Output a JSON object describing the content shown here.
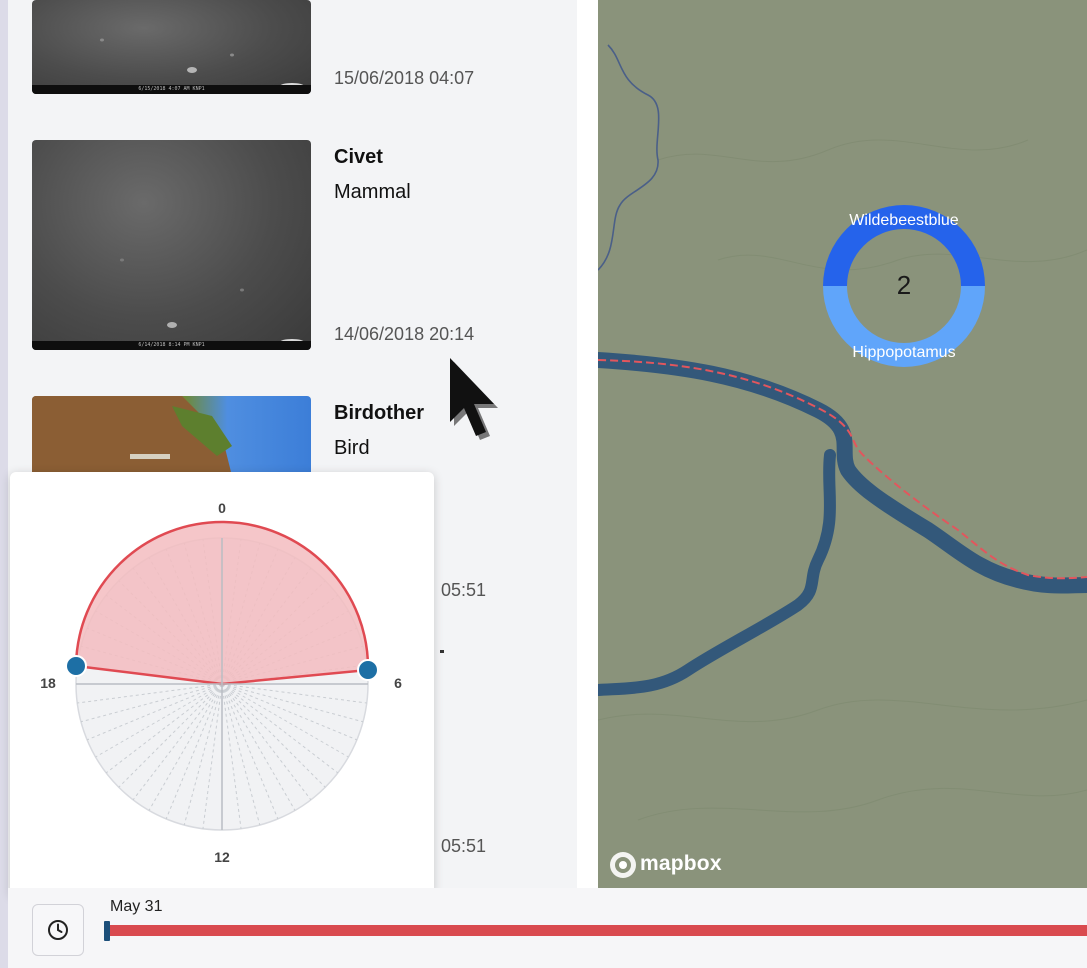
{
  "colors": {
    "map_background": "#8a937b",
    "river": "#33587a",
    "track": "#e2565d",
    "donut_top": "#2563eb",
    "donut_bottom": "#60a5fa",
    "clock_fill": "#f3bcbf",
    "clock_handle": "#1d6fa5",
    "timeline": "#d94a4f"
  },
  "sightings": [
    {
      "species": "",
      "category": "",
      "timestamp": "15/06/2018 04:07",
      "banner": "6/15/2018  4:07 AM  KNP1"
    },
    {
      "species": "Civet",
      "category": "Mammal",
      "timestamp": "14/06/2018 20:14",
      "banner": "6/14/2018  8:14 PM  KNP1"
    },
    {
      "species": "Birdother",
      "category": "Bird",
      "timestamp": "05:51"
    },
    {
      "species": "",
      "category": "",
      "timestamp": "05:51"
    }
  ],
  "map": {
    "cluster": {
      "count": "2",
      "top_label": "Wildebeestblue",
      "bottom_label": "Hippopotamus"
    },
    "attribution": "mapbox"
  },
  "clock_filter": {
    "labels": {
      "top": "0",
      "right": "6",
      "bottom": "12",
      "left": "18"
    },
    "range_start_hour": 18,
    "range_end_hour": 6
  },
  "timeline": {
    "start_label": "May 31",
    "icon": "clock-icon"
  }
}
